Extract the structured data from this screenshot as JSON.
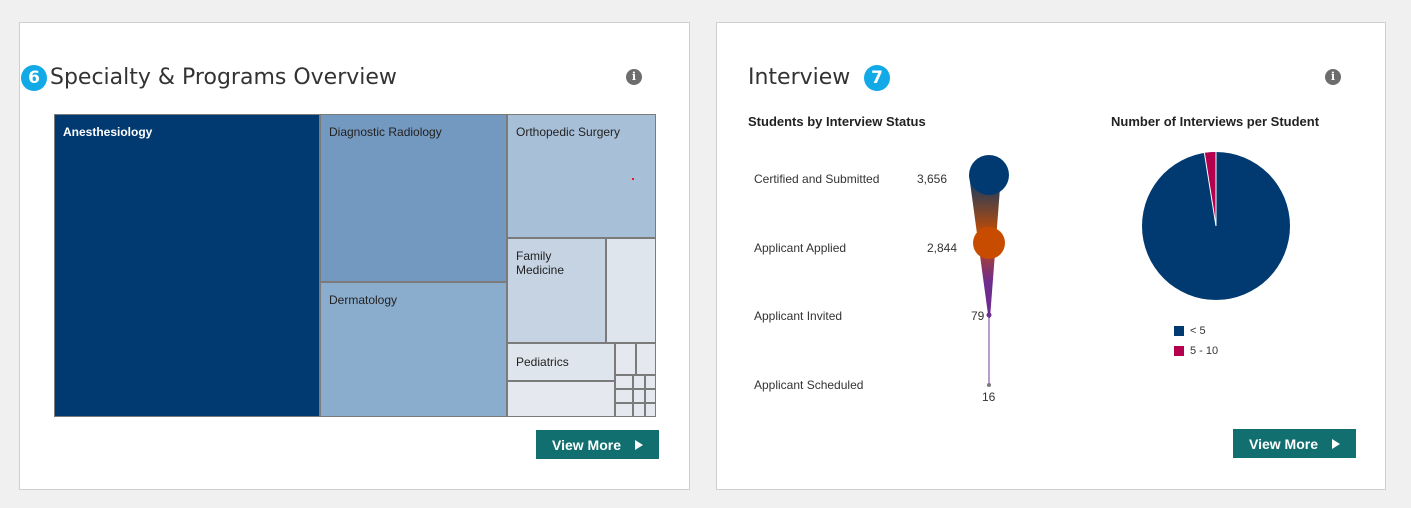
{
  "specialty_card": {
    "badge": "6",
    "title": "Specialty & Programs Overview",
    "info_icon": "info-icon",
    "view_more": "View More",
    "treemap": {
      "tiles": [
        {
          "name": "Anesthesiology",
          "color": "#003a70"
        },
        {
          "name": "Diagnostic Radiology",
          "color": "#7499c0"
        },
        {
          "name": "Dermatology",
          "color": "#8badcd"
        },
        {
          "name": "Orthopedic Surgery",
          "color": "#a8bfd8"
        },
        {
          "name": "Family\nMedicine",
          "color": "#c5d3e3"
        },
        {
          "name": "Pediatrics",
          "color": "#dfe5ec"
        }
      ]
    }
  },
  "interview_card": {
    "badge": "7",
    "title": "Interview",
    "info_icon": "info-icon",
    "view_more": "View More",
    "status_chart": {
      "title": "Students by Interview Status",
      "stages": [
        {
          "label": "Certified and Submitted",
          "value": "3,656",
          "color": "#003a70"
        },
        {
          "label": "Applicant Applied",
          "value": "2,844",
          "color": "#c84c00"
        },
        {
          "label": "Applicant Invited",
          "value": "79",
          "color": "#6e2c8f"
        },
        {
          "label": "Applicant Scheduled",
          "value": "16",
          "color": "#7a7a7a"
        }
      ]
    },
    "per_student_chart": {
      "title": "Number of Interviews per Student",
      "legend": [
        {
          "label": "< 5",
          "color": "#003a70"
        },
        {
          "label": "5 - 10",
          "color": "#b5004e"
        }
      ]
    }
  },
  "chart_data": [
    {
      "type": "treemap",
      "categories": [
        "Anesthesiology",
        "Diagnostic Radiology",
        "Dermatology",
        "Orthopedic Surgery",
        "Family Medicine",
        "Pediatrics"
      ]
    },
    {
      "type": "funnel",
      "title": "Students by Interview Status",
      "categories": [
        "Certified and Submitted",
        "Applicant Applied",
        "Applicant Invited",
        "Applicant Scheduled"
      ],
      "values": [
        3656,
        2844,
        79,
        16
      ]
    },
    {
      "type": "pie",
      "title": "Number of Interviews per Student",
      "categories": [
        "< 5",
        "5 - 10"
      ],
      "values": [
        0.975,
        0.025
      ]
    }
  ]
}
